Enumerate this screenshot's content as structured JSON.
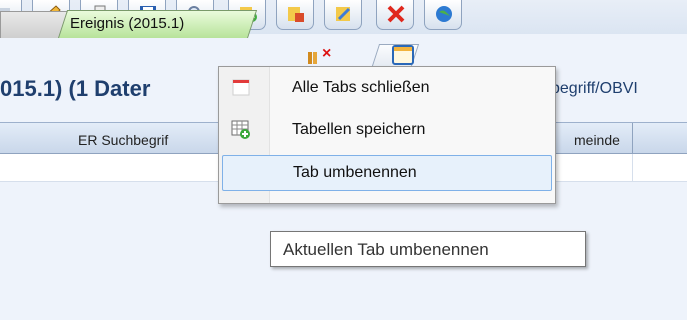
{
  "toolbar": {
    "buttons": [
      {
        "icon": "partial-icon"
      },
      {
        "icon": "pencil-icon"
      },
      {
        "icon": "printer-icon"
      },
      {
        "icon": "save-disk-icon"
      },
      {
        "icon": "search-icon"
      },
      {
        "icon": "add-plus-icon"
      },
      {
        "icon": "export-icon"
      },
      {
        "icon": "edit-check-icon"
      },
      {
        "icon": "delete-x-icon"
      },
      {
        "icon": "globe-icon"
      }
    ]
  },
  "tabs": {
    "active_label": "Ereignis (2015.1)"
  },
  "heading": {
    "left_text": "015.1)  (1 Dater",
    "right_text": "begriff/OBVI"
  },
  "grid": {
    "columns": [
      {
        "label": "ER Suchbegrif"
      },
      {
        "label": "meinde"
      }
    ]
  },
  "context_menu": {
    "items": [
      {
        "label": "Alle Tabs schließen",
        "icon": "close-tabs-icon"
      },
      {
        "label": "Tabellen speichern",
        "icon": "table-save-icon"
      },
      {
        "label": "Tab umbenennen",
        "icon": ""
      }
    ]
  },
  "tooltip": {
    "text": "Aktuellen Tab umbenennen"
  },
  "colors": {
    "active_tab": "#b7e39a",
    "heading": "#1f3f6e",
    "menu_highlight": "#7fb1e8",
    "close_red": "#dd1111"
  }
}
